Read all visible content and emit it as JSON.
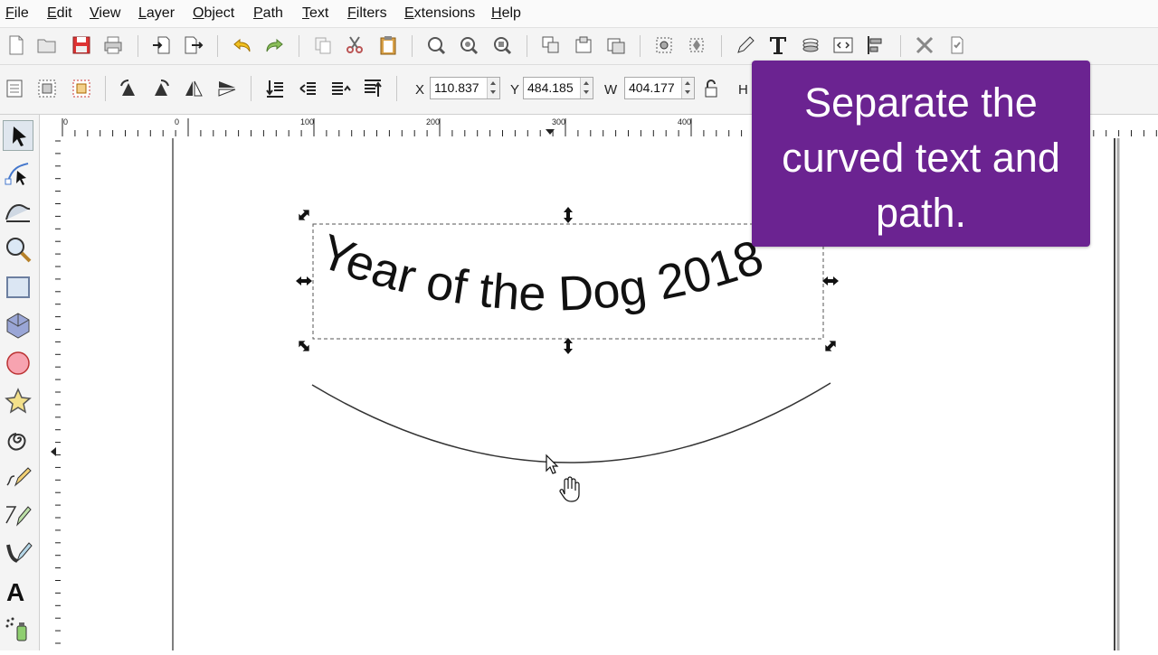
{
  "menu": [
    "File",
    "Edit",
    "View",
    "Layer",
    "Object",
    "Path",
    "Text",
    "Filters",
    "Extensions",
    "Help"
  ],
  "controls": {
    "x_label": "X",
    "x_value": "110.837",
    "y_label": "Y",
    "y_value": "484.185",
    "w_label": "W",
    "w_value": "404.177",
    "h_label": "H"
  },
  "ruler": {
    "h_ticks": [
      "0",
      "0",
      "100",
      "200",
      "300",
      "400"
    ]
  },
  "canvas": {
    "curved_text": "Year of the Dog 2018"
  },
  "callout": {
    "text": "Separate the curved text and path."
  },
  "colors": {
    "callout_bg": "#6b2391",
    "selection": "#555555",
    "path": "#333333"
  },
  "icons": {
    "commands": [
      "new-document",
      "open",
      "save",
      "print",
      "import",
      "export",
      "undo",
      "redo",
      "duplicate",
      "cut",
      "paste",
      "zoom-selection",
      "zoom-drawing",
      "zoom-page",
      "group",
      "ungroup",
      "clone",
      "node-editor",
      "transform",
      "pencil",
      "text",
      "layers",
      "xml-editor",
      "align",
      "preferences",
      "document-properties"
    ],
    "controls": [
      "select-all",
      "select-all-layers",
      "deselect",
      "rotate-ccw",
      "rotate-cw",
      "flip-horizontal",
      "flip-vertical",
      "lower-to-bottom",
      "lower",
      "raise",
      "raise-to-top",
      "lock"
    ],
    "tools": [
      "selector",
      "node",
      "tweak",
      "zoom",
      "rectangle",
      "box-3d",
      "ellipse",
      "star",
      "spiral",
      "pencil",
      "pen",
      "calligraphy",
      "text",
      "spray"
    ]
  }
}
